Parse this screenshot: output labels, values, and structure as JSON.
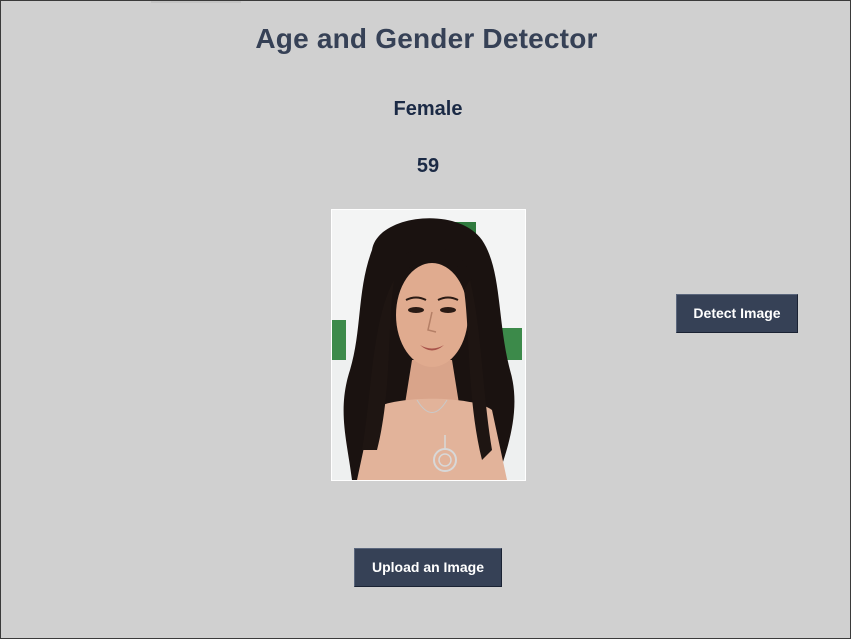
{
  "app": {
    "title": "Age and Gender Detector"
  },
  "result": {
    "gender": "Female",
    "age": "59"
  },
  "preview": {
    "icon": "portrait-photo"
  },
  "buttons": {
    "detect_label": "Detect Image",
    "upload_label": "Upload an Image"
  },
  "colors": {
    "background": "#d0d0d0",
    "title": "#364156",
    "result_text": "#1b2a45",
    "button_bg": "#364156",
    "button_text": "#ffffff"
  }
}
